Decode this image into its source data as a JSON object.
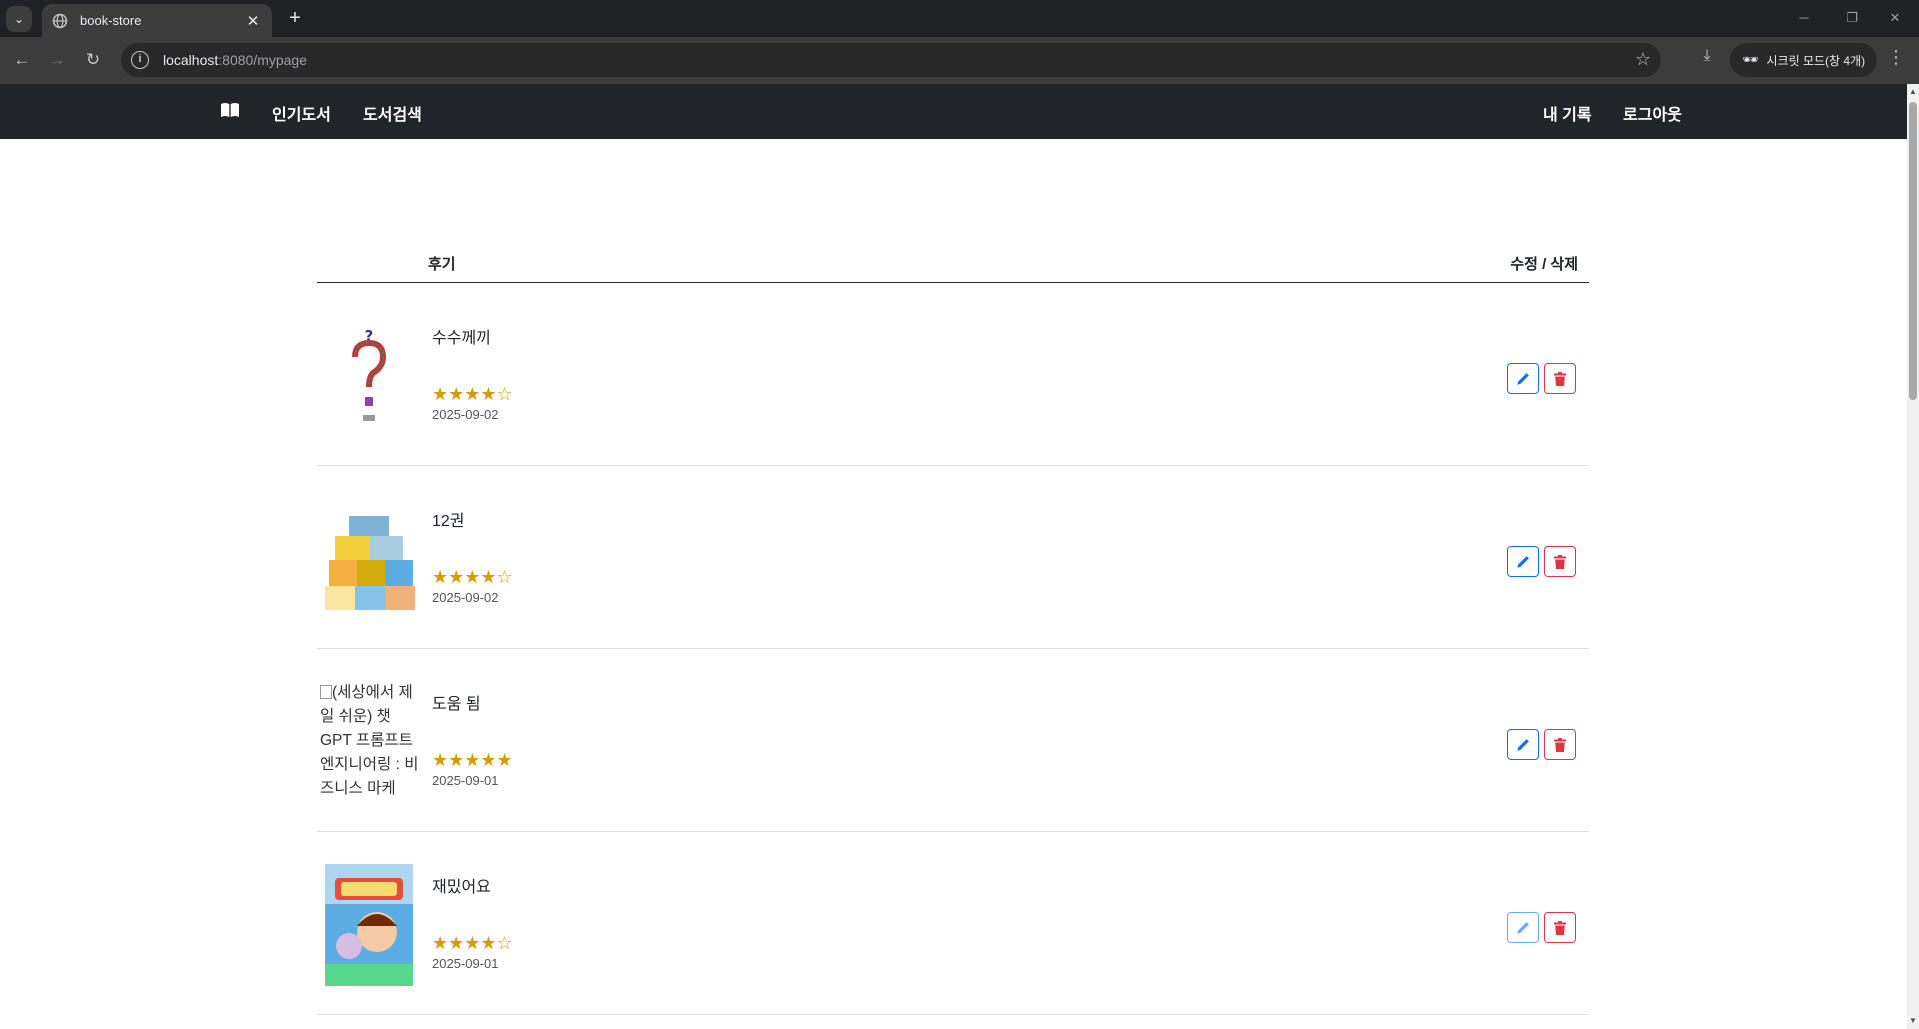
{
  "browser": {
    "tab_title": "book-store",
    "url_host": "localhost",
    "url_path": ":8080/mypage",
    "incognito_label": "시크릿 모드(창 4개)"
  },
  "nav": {
    "logo_icon": "book-open-icon",
    "links": [
      "인기도서",
      "도서검색"
    ],
    "right_links": [
      "내 기록",
      "로그아웃"
    ]
  },
  "table": {
    "header_review": "후기",
    "header_actions": "수정 / 삭제"
  },
  "reviews": [
    {
      "comment": "수수께끼",
      "rating": 4,
      "stars": "★★★★☆",
      "date": "2025-09-02",
      "cover": "image"
    },
    {
      "comment": "12권",
      "rating": 4,
      "stars": "★★★★☆",
      "date": "2025-09-02",
      "cover": "image"
    },
    {
      "comment": "도움 됨",
      "rating": 5,
      "stars": "★★★★★",
      "date": "2025-09-01",
      "cover_alt": "(세상에서 제일 쉬운) 챗GPT 프롬프트 엔지니어링 : 비즈니스 마케"
    },
    {
      "comment": "재밌어요",
      "rating": 4,
      "stars": "★★★★☆",
      "date": "2025-09-01",
      "cover": "image"
    }
  ],
  "colors": {
    "navbar": "#212529",
    "edit": "#0d6efd",
    "delete": "#dc3545",
    "star": "#d99a00"
  }
}
